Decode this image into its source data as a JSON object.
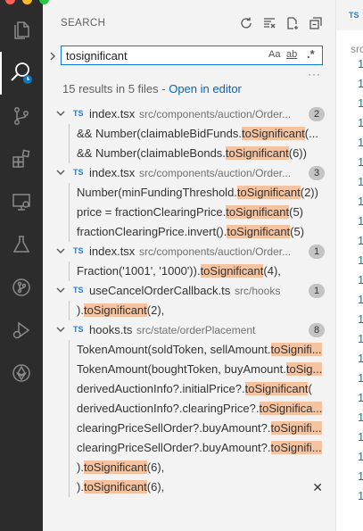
{
  "window": {
    "dot_colors": [
      "#ff5f57",
      "#febc2e",
      "#28c840"
    ]
  },
  "activity_bar": [
    {
      "name": "explorer-icon"
    },
    {
      "name": "search-icon",
      "active": true
    },
    {
      "name": "source-control-icon"
    },
    {
      "name": "extensions-icon"
    },
    {
      "name": "remote-explorer-icon"
    },
    {
      "name": "testing-icon"
    },
    {
      "name": "git-graph-icon"
    },
    {
      "name": "run-debug-icon"
    },
    {
      "name": "ethereum-icon"
    }
  ],
  "sidebar": {
    "title": "SEARCH",
    "search_value": "tosignificant",
    "opt_case": "Aa",
    "opt_word": "ab",
    "opt_regex": ".*",
    "more": "···",
    "summary": "15 results in 5 files - ",
    "open_in_editor": "Open in editor"
  },
  "results": [
    {
      "lang": "TS",
      "name": "index.tsx",
      "path": "src/components/auction/Order...",
      "count": "2",
      "matches": [
        {
          "pre": "&& Number(claimableBidFunds.",
          "hit": "toSignificant",
          "post": "(..."
        },
        {
          "pre": "&& Number(claimableBonds.",
          "hit": "toSignificant",
          "post": "(6))"
        }
      ]
    },
    {
      "lang": "TS",
      "name": "index.tsx",
      "path": "src/components/auction/Order...",
      "count": "3",
      "matches": [
        {
          "pre": "Number(minFundingThreshold.",
          "hit": "toSignificant",
          "post": "(2))"
        },
        {
          "pre": "price = fractionClearingPrice.",
          "hit": "toSignificant",
          "post": "(5)"
        },
        {
          "pre": "fractionClearingPrice.invert().",
          "hit": "toSignificant",
          "post": "(5)"
        }
      ]
    },
    {
      "lang": "TS",
      "name": "index.tsx",
      "path": "src/components/auction/Order...",
      "count": "1",
      "matches": [
        {
          "pre": "Fraction('1001', '1000')).",
          "hit": "toSignificant",
          "post": "(4),"
        }
      ]
    },
    {
      "lang": "TS",
      "name": "useCancelOrderCallback.ts",
      "path": "src/hooks",
      "count": "1",
      "matches": [
        {
          "pre": ").",
          "hit": "toSignificant",
          "post": "(2),"
        }
      ]
    },
    {
      "lang": "TS",
      "name": "hooks.ts",
      "path": "src/state/orderPlacement",
      "count": "8",
      "matches": [
        {
          "pre": "TokenAmount(soldToken, sellAmount.",
          "hit": "toSignifi...",
          "post": ""
        },
        {
          "pre": "TokenAmount(boughtToken, buyAmount.",
          "hit": "toSig...",
          "post": ""
        },
        {
          "pre": "derivedAuctionInfo?.initialPrice?.",
          "hit": "toSignificant",
          "post": "("
        },
        {
          "pre": "derivedAuctionInfo?.clearingPrice?.",
          "hit": "toSignifica...",
          "post": ""
        },
        {
          "pre": "clearingPriceSellOrder?.buyAmount?.",
          "hit": "toSignifi...",
          "post": ""
        },
        {
          "pre": "clearingPriceSellOrder?.buyAmount?.",
          "hit": "toSignifi...",
          "post": ""
        },
        {
          "pre": ").",
          "hit": "toSignificant",
          "post": "(6),"
        },
        {
          "pre": ").",
          "hit": "toSignificant",
          "post": "(6),",
          "close": "✕"
        }
      ]
    }
  ],
  "editor": {
    "tab_lang": "TS",
    "crumb": "src",
    "line_numbers": [
      "1",
      "1",
      "1",
      "1",
      "1",
      "1",
      "1",
      "1",
      "1",
      "1",
      "1",
      "1",
      "1",
      "1",
      "1",
      "1",
      "1",
      "1",
      "1",
      "1",
      "1",
      "1",
      "1"
    ]
  }
}
